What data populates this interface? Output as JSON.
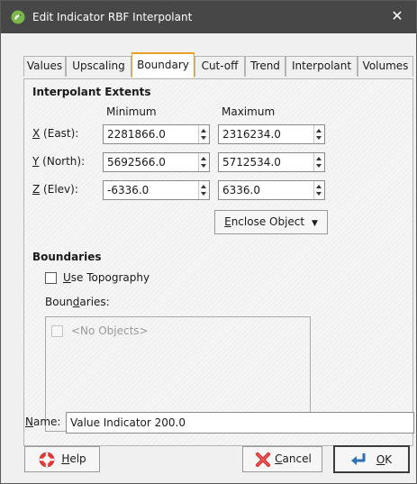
{
  "window": {
    "title": "Edit Indicator RBF Interpolant",
    "close_glyph": "✕",
    "app_icon": "leapfrog-app-icon"
  },
  "tabs": [
    {
      "label": "Values",
      "active": false
    },
    {
      "label": "Upscaling",
      "active": false
    },
    {
      "label": "Boundary",
      "active": true
    },
    {
      "label": "Cut-off",
      "active": false
    },
    {
      "label": "Trend",
      "active": false
    },
    {
      "label": "Interpolant",
      "active": false
    },
    {
      "label": "Volumes",
      "active": false
    }
  ],
  "extents": {
    "section_title": "Interpolant Extents",
    "col_min": "Minimum",
    "col_max": "Maximum",
    "rows": [
      {
        "mnemonic": "X",
        "rest": " (East):",
        "min": "2281866.0",
        "max": "2316234.0"
      },
      {
        "mnemonic": "Y",
        "rest": " (North):",
        "min": "5692566.0",
        "max": "5712534.0"
      },
      {
        "mnemonic": "Z",
        "rest": " (Elev):",
        "min": "-6336.0",
        "max": "6336.0"
      }
    ],
    "enclose_mnemonic": "E",
    "enclose_rest": "nclose Object",
    "enclose_arrow": "▼"
  },
  "boundaries": {
    "section_title": "Boundaries",
    "use_topo_mnemonic": "U",
    "use_topo_rest": "se Topography",
    "use_topo_checked": false,
    "list_label_pre": "Boun",
    "list_label_mnemonic": "d",
    "list_label_post": "aries:",
    "list_items": [
      "<No Objects>"
    ]
  },
  "name_field": {
    "label_mnemonic": "N",
    "label_rest": "ame:",
    "value": "Value Indicator 200.0"
  },
  "buttons": {
    "help_mnemonic": "H",
    "help_rest": "elp",
    "cancel_mnemonic": "C",
    "cancel_rest": "ancel",
    "ok_mnemonic": "O",
    "ok_rest": "K"
  },
  "colors": {
    "titlebar": "#474747",
    "active_tab_accent": "#e8a02a",
    "ok_button_border": "#3c3c3c"
  }
}
